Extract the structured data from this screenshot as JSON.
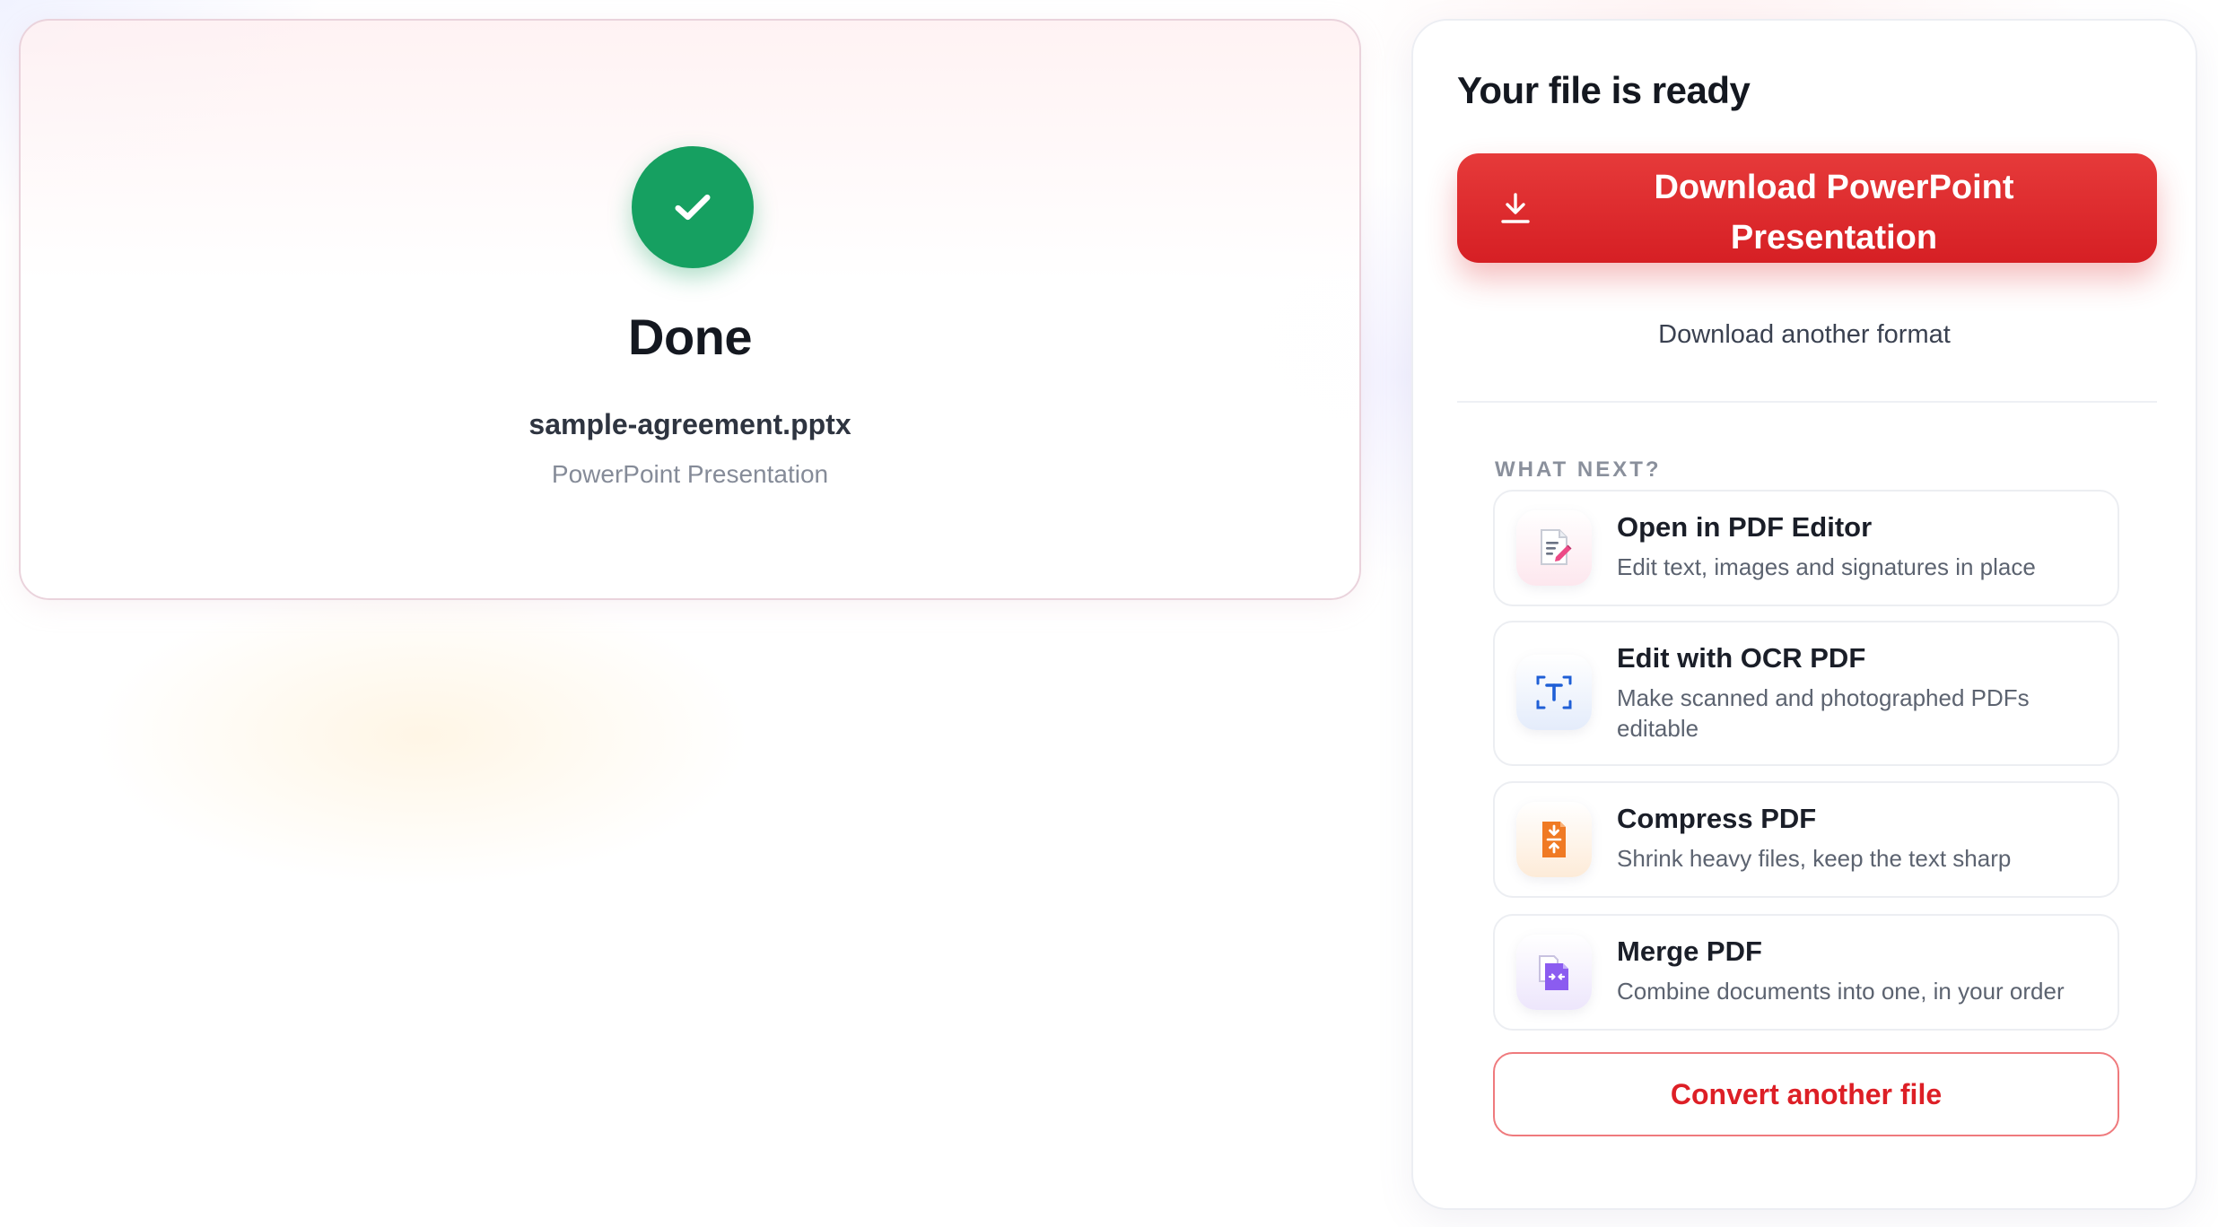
{
  "status": {
    "title": "Done",
    "file_name": "sample-agreement.pptx",
    "file_type": "PowerPoint Presentation",
    "icon": "check-icon",
    "success_color": "#16a061"
  },
  "panel": {
    "title": "Your file is ready",
    "download_button": {
      "label": "Download PowerPoint Presentation",
      "icon": "download-icon",
      "color": "#dd2326"
    },
    "another_format_label": "Download another format",
    "section_label": "WHAT NEXT?",
    "tools": [
      {
        "title": "Open in PDF Editor",
        "description": "Edit text, images and signatures in place",
        "icon": "pdf-editor-icon"
      },
      {
        "title": "Edit with OCR PDF",
        "description": "Make scanned and photographed PDFs editable",
        "icon": "ocr-icon"
      },
      {
        "title": "Compress PDF",
        "description": "Shrink heavy files, keep the text sharp",
        "icon": "compress-icon"
      },
      {
        "title": "Merge PDF",
        "description": "Combine documents into one, in your order",
        "icon": "merge-icon"
      }
    ],
    "convert_button_label": "Convert another file",
    "accent_color": "#dd1f26"
  }
}
